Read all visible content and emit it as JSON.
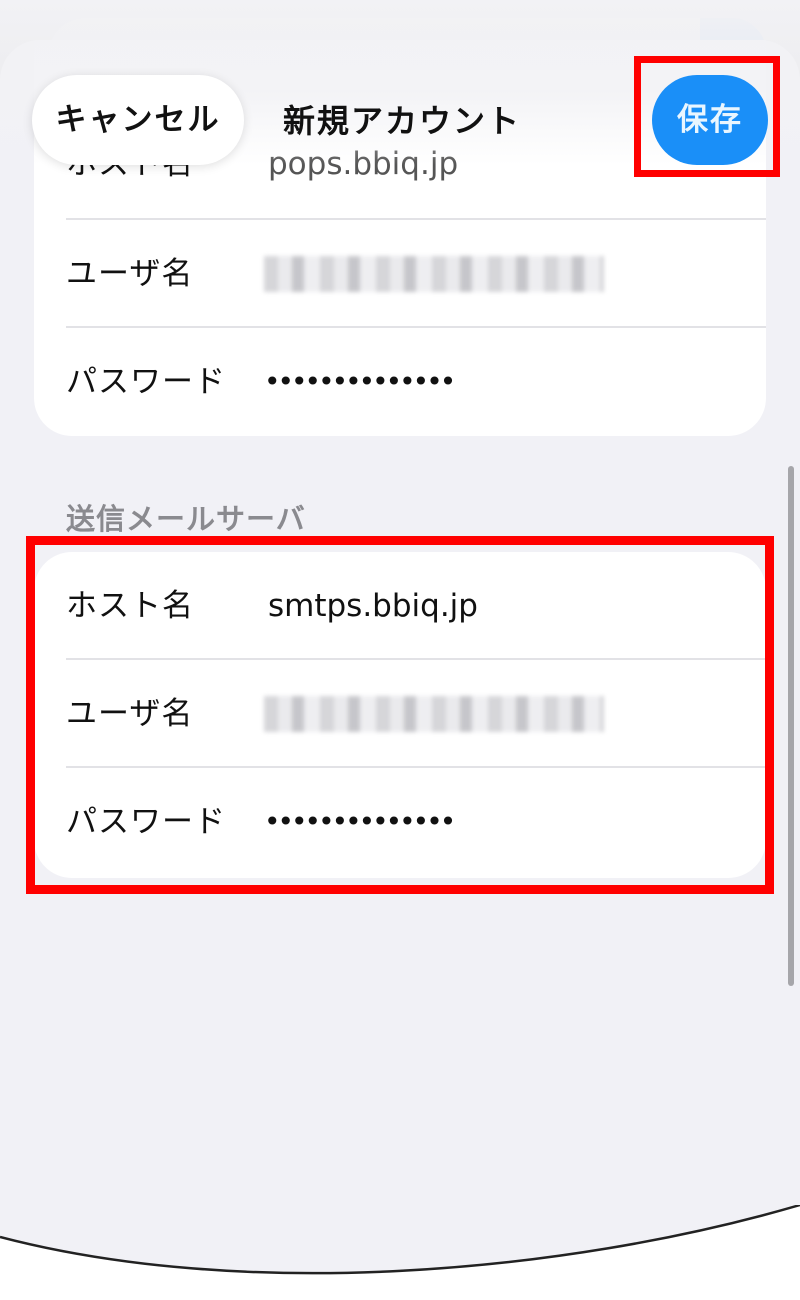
{
  "nav": {
    "cancel_label": "キャンセル",
    "title": "新規アカウント",
    "save_label": "保存"
  },
  "incoming_server": {
    "rows": [
      {
        "label": "ホスト名",
        "value": "pops.bbiq.jp"
      },
      {
        "label": "ユーザ名",
        "value": ""
      },
      {
        "label": "パスワード",
        "value": "••••••••••••••"
      }
    ]
  },
  "outgoing_server": {
    "header": "送信メールサーバ",
    "rows": [
      {
        "label": "ホスト名",
        "value": "smtps.bbiq.jp"
      },
      {
        "label": "ユーザ名",
        "value": ""
      },
      {
        "label": "パスワード",
        "value": "••••••••••••••"
      }
    ]
  },
  "colors": {
    "accent": "#1a8ff8",
    "highlight": "#ff0000",
    "background": "#f1f1f6",
    "card": "#ffffff"
  }
}
